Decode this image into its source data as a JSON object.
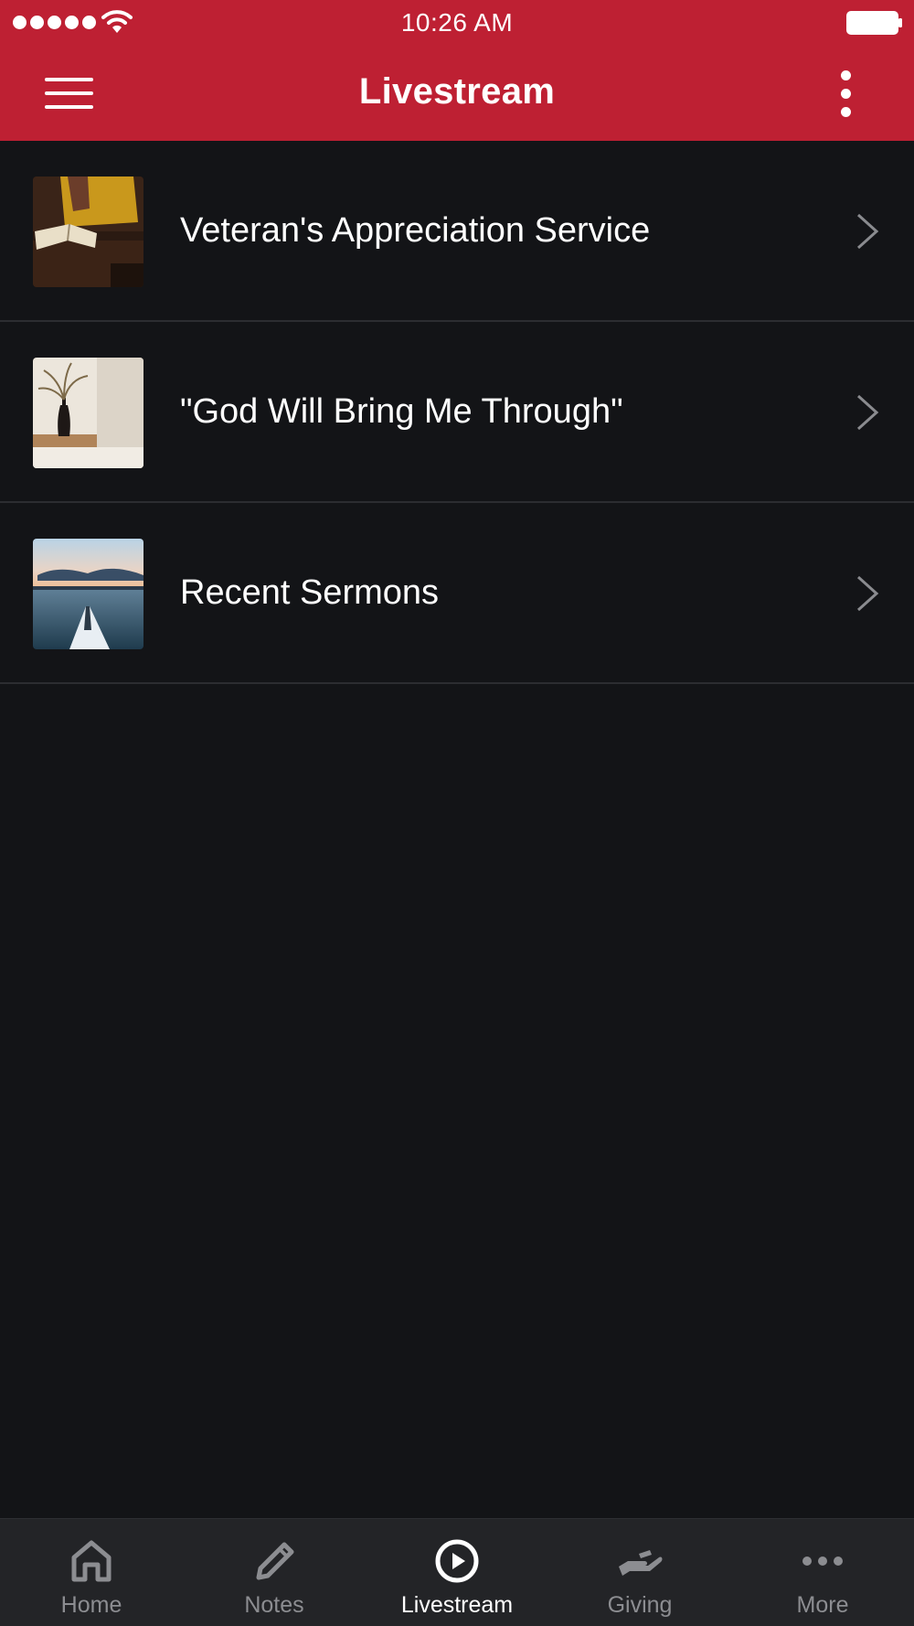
{
  "status_bar": {
    "time": "10:26 AM"
  },
  "header": {
    "title": "Livestream",
    "menu_icon": "hamburger-menu-icon",
    "more_icon": "vertical-ellipsis-icon"
  },
  "colors": {
    "header_bg": "#be2033",
    "page_bg": "#131417",
    "tabbar_bg": "#232427",
    "active_tab": "#ffffff",
    "inactive_tab": "#8c8d91"
  },
  "items": [
    {
      "label": "Veteran's Appreciation Service",
      "thumbnail": "person-reading-bible-image"
    },
    {
      "label": "\"God Will Bring Me Through\"",
      "thumbnail": "vase-with-dried-plant-image"
    },
    {
      "label": "Recent Sermons",
      "thumbnail": "kayak-on-lake-at-sunset-image"
    }
  ],
  "tabs": [
    {
      "label": "Home",
      "icon": "home-icon",
      "active": false
    },
    {
      "label": "Notes",
      "icon": "pencil-icon",
      "active": false
    },
    {
      "label": "Livestream",
      "icon": "play-circle-icon",
      "active": true
    },
    {
      "label": "Giving",
      "icon": "giving-hand-icon",
      "active": false
    },
    {
      "label": "More",
      "icon": "horizontal-ellipsis-icon",
      "active": false
    }
  ]
}
